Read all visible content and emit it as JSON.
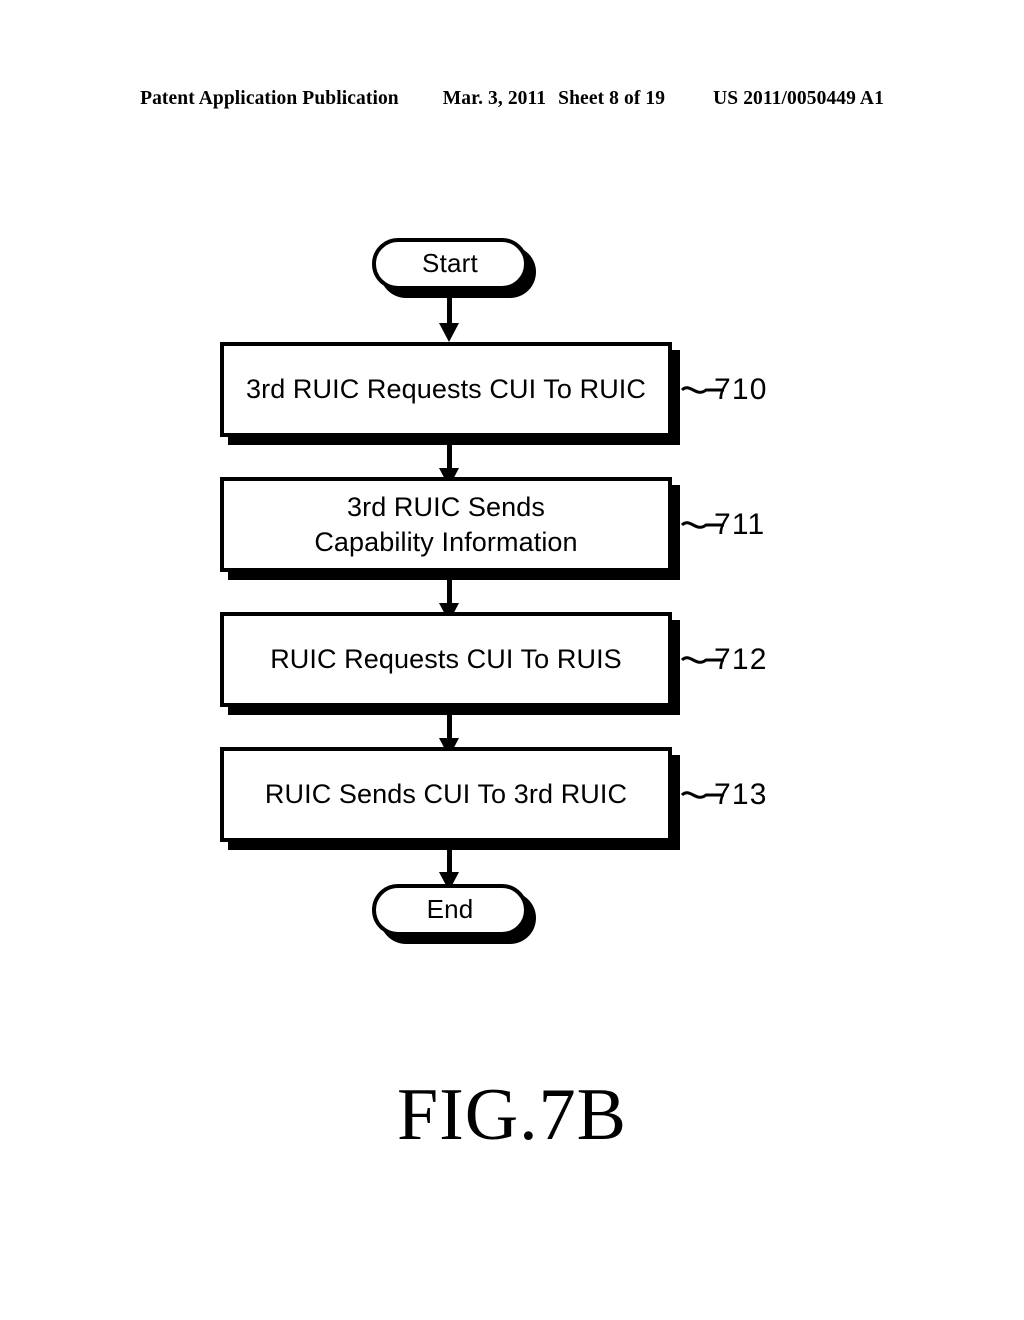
{
  "header": {
    "publication": "Patent Application Publication",
    "date": "Mar. 3, 2011",
    "sheet": "Sheet 8 of 19",
    "patent_number": "US 2011/0050449 A1"
  },
  "figure": {
    "caption": "FIG.7B"
  },
  "flowchart": {
    "start_label": "Start",
    "end_label": "End",
    "steps": [
      {
        "text": "3rd RUIC Requests CUI To RUIC",
        "ref": "710"
      },
      {
        "text": "3rd RUIC Sends\nCapability Information",
        "ref": "711"
      },
      {
        "text": "RUIC Requests CUI To RUIS",
        "ref": "712"
      },
      {
        "text": "RUIC Sends CUI To 3rd RUIC",
        "ref": "713"
      }
    ]
  }
}
